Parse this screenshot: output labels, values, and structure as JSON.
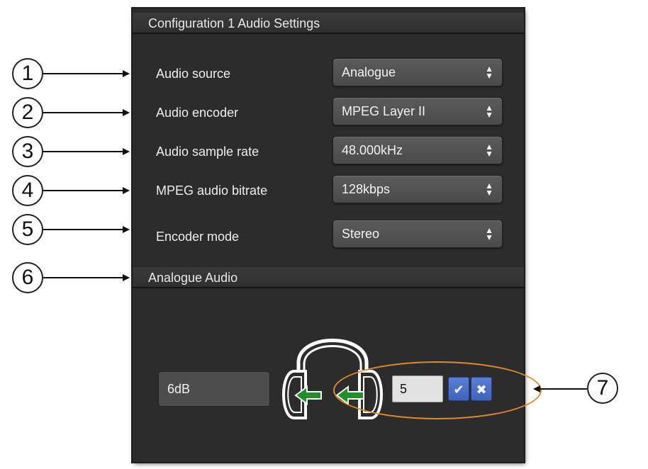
{
  "panel": {
    "title": "Configuration 1 Audio Settings",
    "rows": [
      {
        "label": "Audio source",
        "value": "Analogue"
      },
      {
        "label": "Audio encoder",
        "value": "MPEG Layer II"
      },
      {
        "label": "Audio sample rate",
        "value": "48.000kHz"
      },
      {
        "label": "MPEG audio bitrate",
        "value": "128kbps"
      },
      {
        "label": "Encoder mode",
        "value": "Stereo"
      }
    ],
    "select_icon": "up-down-arrows-icon"
  },
  "analogue": {
    "title": "Analogue Audio",
    "gain_display": "6dB",
    "gain_input": "5",
    "headphones_icon": "headphones-icon",
    "confirm_icon": "checkmark-icon",
    "cancel_icon": "cancel-icon"
  },
  "callouts": [
    "1",
    "2",
    "3",
    "4",
    "5",
    "6",
    "7"
  ],
  "colors": {
    "panel_bg": "#2c2c2c",
    "select_bg": "#4f4f4f",
    "button_blue": "#4a6fca",
    "highlight": "#e08a2e",
    "arrow_green": "#1f8f2a"
  }
}
